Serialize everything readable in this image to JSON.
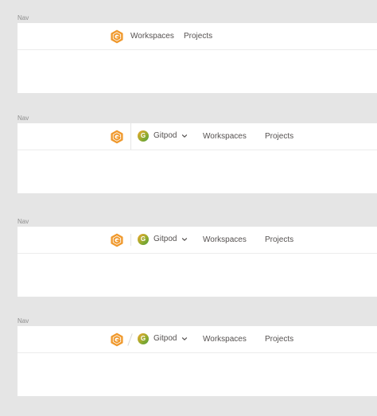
{
  "brand": {
    "logo_icon": "gitpod-logo-icon",
    "logo_color": "#f0992d",
    "avatar_gradient": [
      "#f0a730",
      "#4f9e3a"
    ]
  },
  "variants": [
    {
      "label": "Nav",
      "links": {
        "workspaces": "Workspaces",
        "projects": "Projects"
      }
    },
    {
      "label": "Nav",
      "org": {
        "avatar_letter": "G",
        "name": "Gitpod",
        "dropdown_icon": "chevron-down-icon"
      },
      "links": {
        "workspaces": "Workspaces",
        "projects": "Projects"
      }
    },
    {
      "label": "Nav",
      "org": {
        "avatar_letter": "G",
        "name": "Gitpod",
        "dropdown_icon": "chevron-down-icon"
      },
      "links": {
        "workspaces": "Workspaces",
        "projects": "Projects"
      }
    },
    {
      "label": "Nav",
      "org": {
        "avatar_letter": "G",
        "name": "Gitpod",
        "dropdown_icon": "chevron-down-icon"
      },
      "links": {
        "workspaces": "Workspaces",
        "projects": "Projects"
      }
    }
  ]
}
